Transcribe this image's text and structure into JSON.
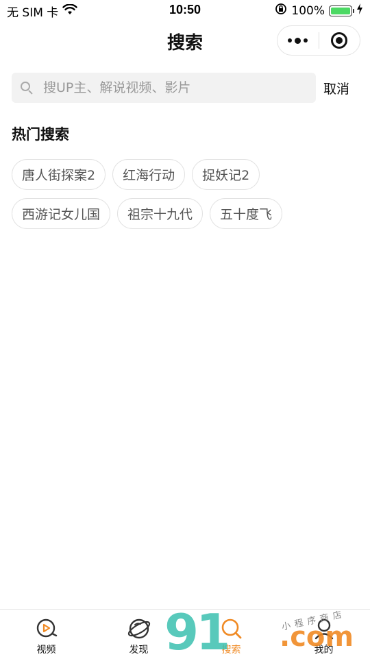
{
  "status_bar": {
    "carrier": "无 SIM 卡",
    "time": "10:50",
    "battery_percent": "100%",
    "battery_level": 1.0,
    "battery_color": "#4cd964"
  },
  "nav": {
    "title": "搜索"
  },
  "search": {
    "placeholder": "搜UP主、解说视频、影片",
    "value": "",
    "cancel_label": "取消"
  },
  "hot_search": {
    "title": "热门搜索",
    "tags": [
      "唐人街探案2",
      "红海行动",
      "捉妖记2",
      "西游记女儿国",
      "祖宗十九代",
      "五十度飞"
    ]
  },
  "tabbar": {
    "active_color": "#f08a24",
    "items": [
      {
        "label": "视频",
        "icon": "video-play-icon"
      },
      {
        "label": "发现",
        "icon": "planet-icon"
      },
      {
        "label": "搜索",
        "icon": "search-icon",
        "active": true
      },
      {
        "label": "我的",
        "icon": "user-icon"
      }
    ]
  },
  "watermark": {
    "brand_digits": "91",
    "brand_suffix": ".com",
    "tagline": "小程序商店",
    "colors": {
      "digits": "#3cc0b0",
      "suffix": "#f08a24"
    }
  }
}
